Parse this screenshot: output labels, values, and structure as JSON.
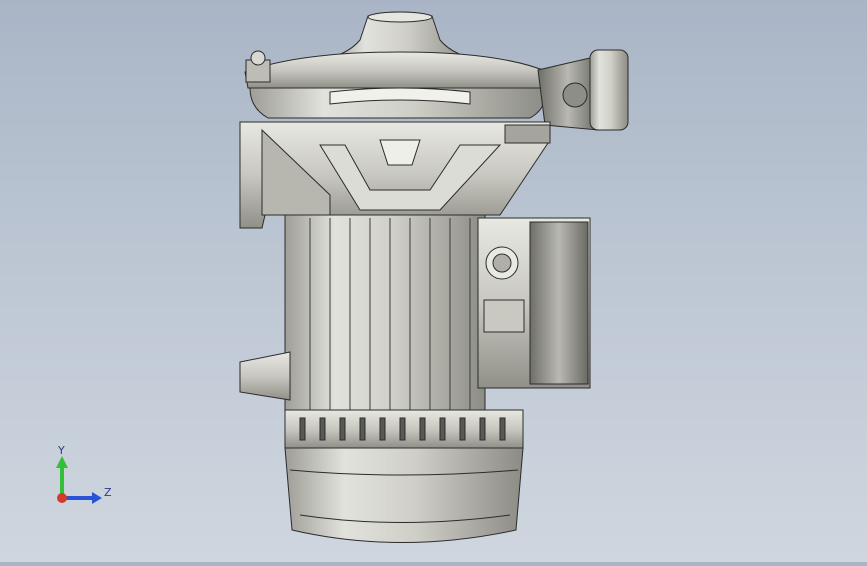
{
  "viewport": {
    "background_top": "#a9b5c6",
    "background_bottom": "#cfd6df"
  },
  "model": {
    "body_color": "#d4d4ce",
    "shadow_color": "#8f8f88",
    "edge_color": "#2b2b2b"
  },
  "triad": {
    "x_axis_color": "#d23a2a",
    "y_axis_color": "#32c03a",
    "z_axis_color": "#2b53d8",
    "y_label": "Y",
    "z_label": "Z"
  }
}
